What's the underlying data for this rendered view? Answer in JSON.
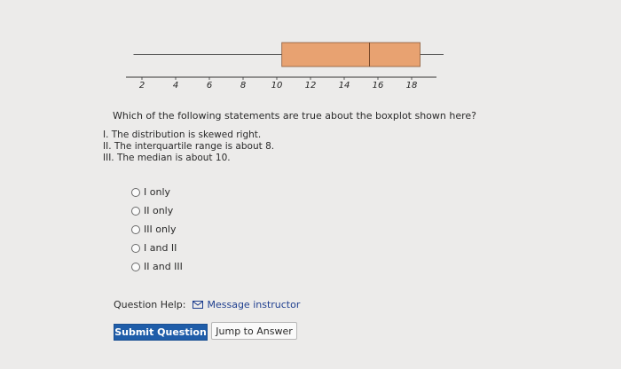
{
  "chart_data": {
    "type": "boxplot",
    "min": 1.5,
    "q1": 10.3,
    "median": 15.5,
    "q3": 18.5,
    "max": 20,
    "ticks": [
      2,
      4,
      6,
      8,
      10,
      12,
      14,
      16,
      18
    ],
    "xlim": [
      1.5,
      20
    ],
    "box_color": "#e8a271"
  },
  "question": {
    "prompt": "Which of the following statements are true about the boxplot shown here?",
    "statements": [
      "I. The distribution is skewed right.",
      "II. The interquartile range is about 8.",
      "III. The median is about 10."
    ]
  },
  "choices": [
    "I only",
    "II only",
    "III only",
    "I and II",
    "II and III"
  ],
  "help": {
    "label": "Question Help:",
    "message_link": "Message instructor",
    "icon": "envelope-icon"
  },
  "buttons": {
    "submit": "Submit Question",
    "jump": "Jump to Answer"
  },
  "colors": {
    "accent": "#1f5da9",
    "box": "#e8a271"
  }
}
